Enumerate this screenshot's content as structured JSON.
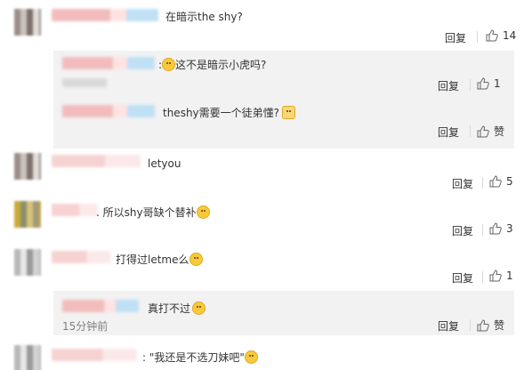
{
  "comments": [
    {
      "text": "在暗示the shy?",
      "reply_label": "回复",
      "like_count": "14"
    },
    {
      "text": "这不是暗示小虎吗?",
      "reply_label": "回复",
      "like_count": "1"
    },
    {
      "text": "theshy需要一个徒弟懂?",
      "reply_label": "回复",
      "like_count": "赞"
    },
    {
      "text": "letyou",
      "reply_label": "回复",
      "like_count": "5"
    },
    {
      "text": "所以shy哥缺个替补",
      "reply_label": "回复",
      "like_count": "3"
    },
    {
      "text": "打得过letme么",
      "reply_label": "回复",
      "like_count": "1"
    },
    {
      "text": "真打不过",
      "reply_label": "回复",
      "like_count": "赞",
      "time": "15分钟前"
    },
    {
      "text": "\"我还是不选刀妹吧\""
    }
  ],
  "icons": {
    "like": "thumbs-up-icon",
    "emoji": "emoji-icon"
  },
  "colors": {
    "reply_bg": "#f2f2f2",
    "divider": "#d9d9d9",
    "time": "#808080"
  }
}
